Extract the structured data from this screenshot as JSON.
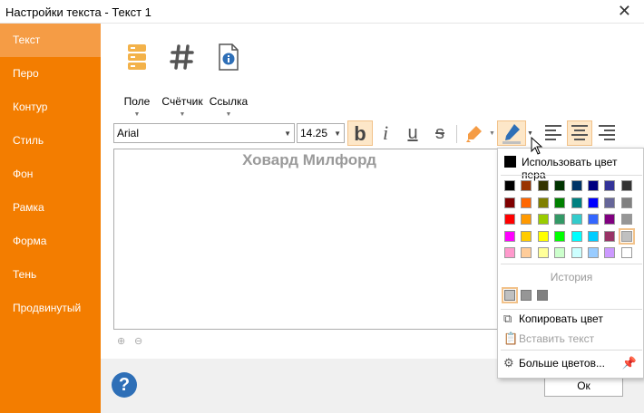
{
  "window": {
    "title": "Настройки текста - Текст 1",
    "close_glyph": "✕"
  },
  "sidebar": {
    "items": [
      {
        "label": "Текст",
        "active": true
      },
      {
        "label": "Перо"
      },
      {
        "label": "Контур"
      },
      {
        "label": "Стиль"
      },
      {
        "label": "Фон"
      },
      {
        "label": "Рамка"
      },
      {
        "label": "Форма"
      },
      {
        "label": "Тень"
      },
      {
        "label": "Продвинутый"
      }
    ]
  },
  "ribbon": {
    "field_label": "Поле",
    "counter_label": "Счётчик",
    "link_label": "Ссылка",
    "icons": [
      "database-icon",
      "hash-icon",
      "info-document-icon"
    ]
  },
  "toolbar": {
    "font_name": "Arial",
    "font_size": "14.25",
    "bold_glyph": "b",
    "italic_glyph": "i",
    "underline_glyph": "u",
    "strike_glyph": "s",
    "bold_active": true,
    "align_center_active": true
  },
  "editor": {
    "text": "Ховард Милфорд"
  },
  "color_popup": {
    "use_pen_label": "Использовать цвет пера",
    "history_label": "История",
    "copy_label": "Копировать цвет",
    "paste_label": "Вставить текст",
    "more_label": "Больше цветов...",
    "palette": [
      [
        "#993300",
        "#333300",
        "#003300",
        "#003366",
        "#000080",
        "#333399",
        "#333333"
      ],
      [
        "#800000",
        "#ff6600",
        "#808000",
        "#008000",
        "#008080",
        "#0000ff",
        "#666699",
        "#808080"
      ],
      [
        "#ff0000",
        "#ff9900",
        "#99cc00",
        "#339966",
        "#33cccc",
        "#3366ff",
        "#800080",
        "#969696"
      ],
      [
        "#ff00ff",
        "#ffcc00",
        "#ffff00",
        "#00ff00",
        "#00ffff",
        "#00ccff",
        "#993366",
        "#c0c0c0"
      ],
      [
        "#ff99cc",
        "#ffcc99",
        "#ffff99",
        "#ccffcc",
        "#ccffff",
        "#99ccff",
        "#cc99ff",
        "#ffffff"
      ]
    ],
    "history": [
      "#c0c0c0",
      "#969696",
      "#808080"
    ]
  },
  "buttons": {
    "ok_label": "Ок",
    "help_glyph": "?"
  },
  "colors": {
    "accent": "#f37d00",
    "accent_active": "#f59c45",
    "link_blue": "#2e6fb7"
  }
}
